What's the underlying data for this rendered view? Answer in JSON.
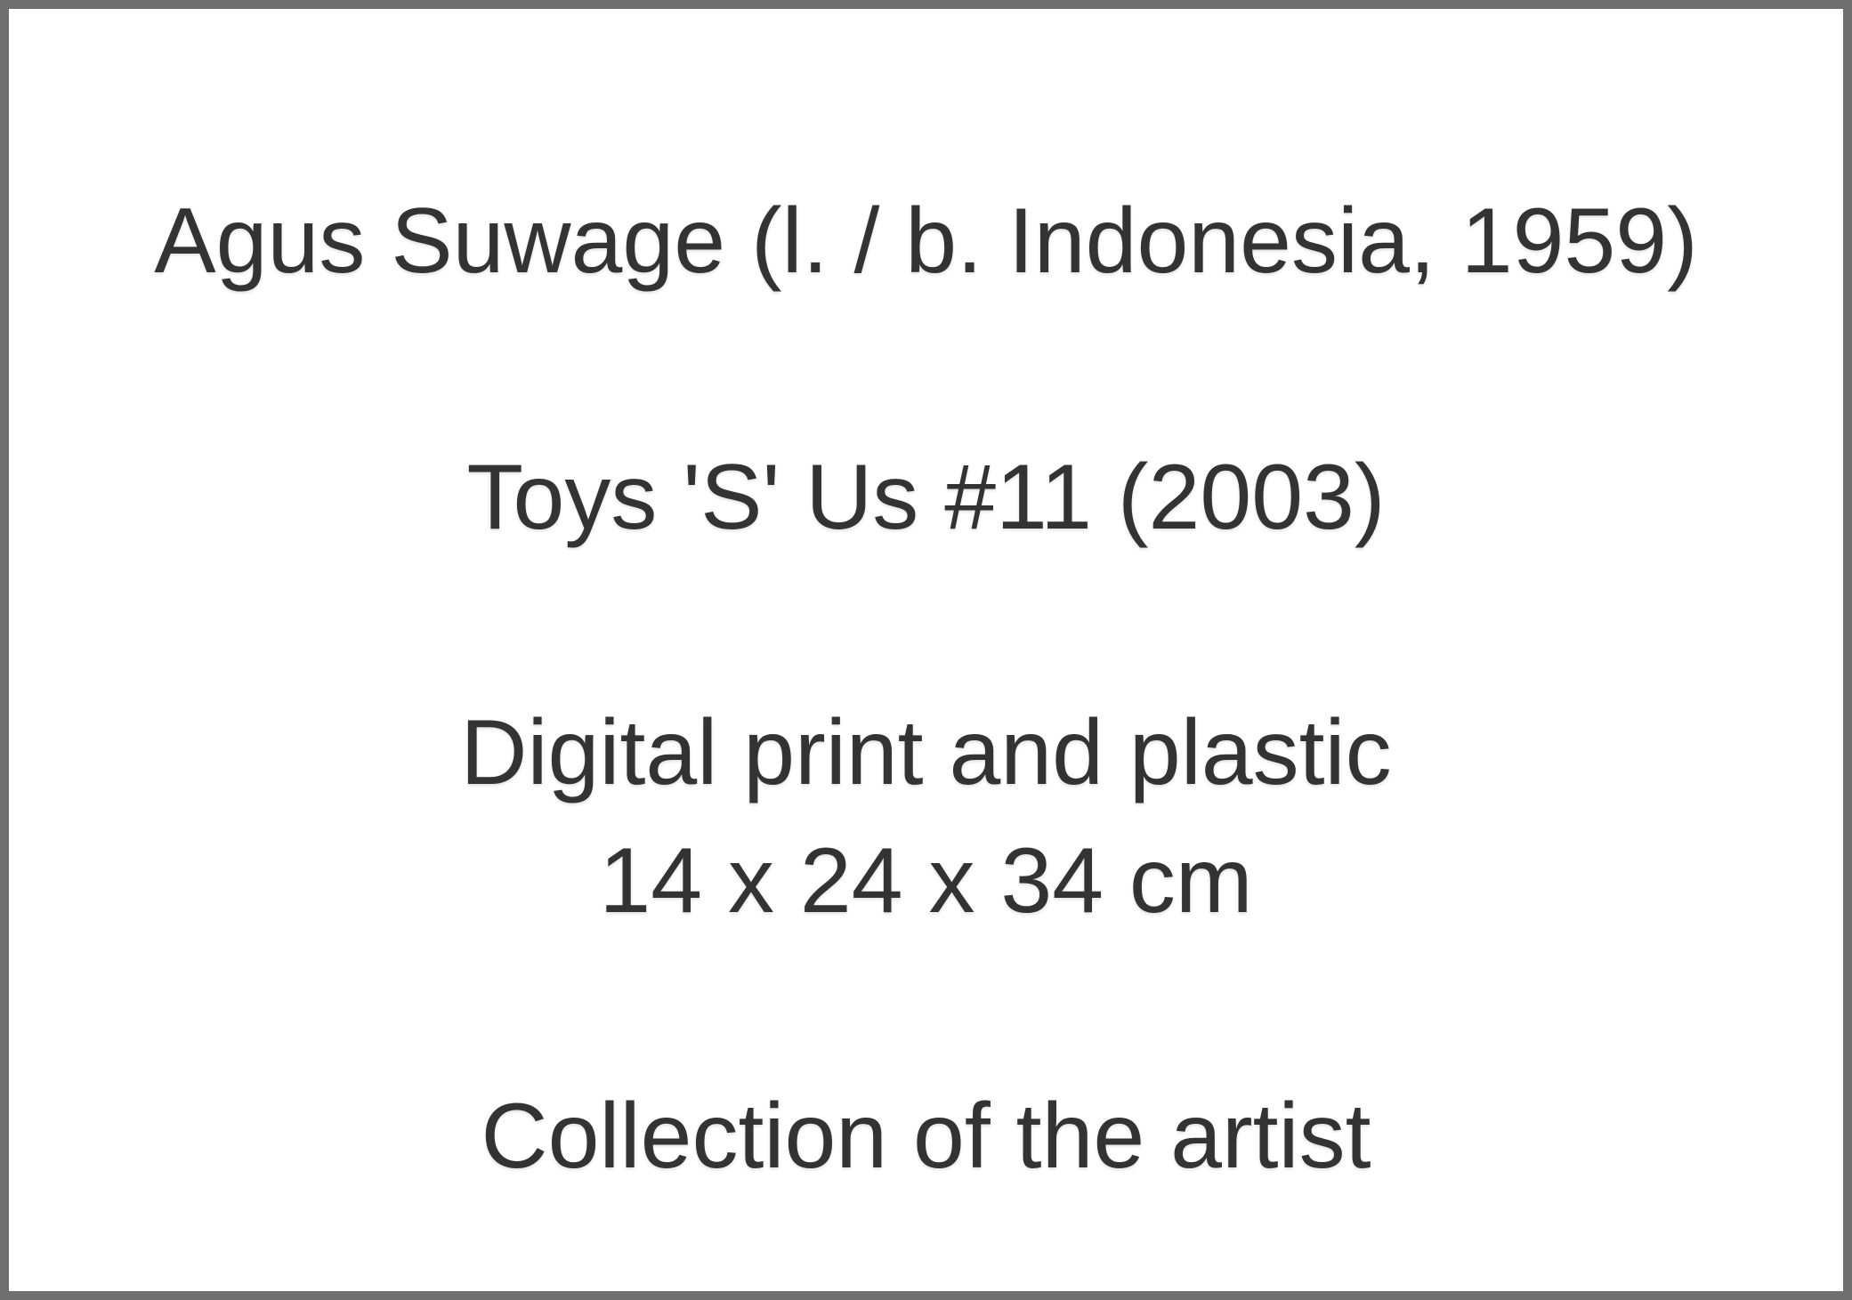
{
  "label": {
    "artist": "Agus Suwage (l. / b. Indonesia, 1959)",
    "title": "Toys 'S' Us #11 (2003)",
    "medium": "Digital print and plastic",
    "dimensions": "14 x 24 x 34 cm",
    "credit": "Collection of the artist"
  },
  "colors": {
    "text": "#333333",
    "border": "#6f6f6f",
    "background": "#ffffff"
  }
}
